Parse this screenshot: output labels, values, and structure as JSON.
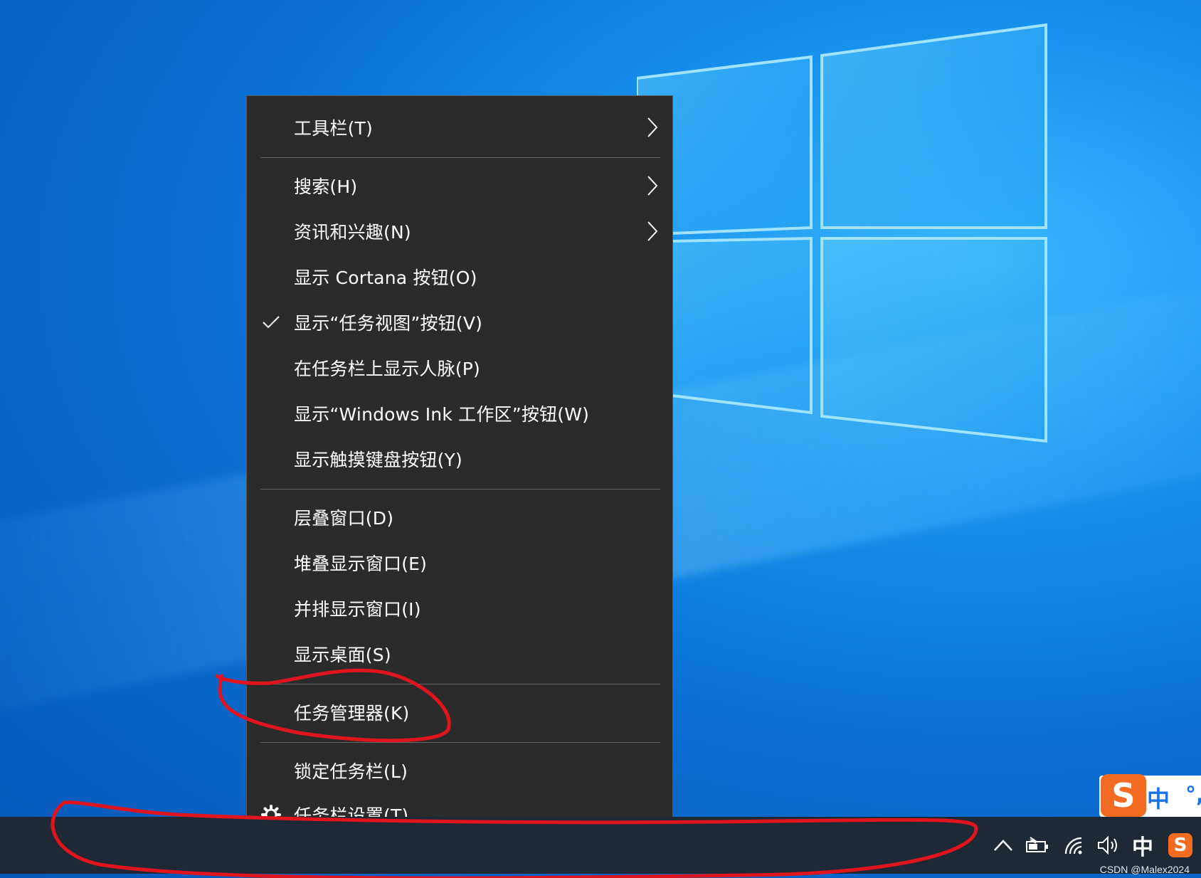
{
  "menu": {
    "items": [
      {
        "label": "工具栏(T)",
        "submenu": true
      },
      {
        "label": "搜索(H)",
        "submenu": true
      },
      {
        "label": "资讯和兴趣(N)",
        "submenu": true
      },
      {
        "label": "显示 Cortana 按钮(O)"
      },
      {
        "label": "显示“任务视图”按钮(V)",
        "checked": true
      },
      {
        "label": "在任务栏上显示人脉(P)"
      },
      {
        "label": "显示“Windows Ink 工作区”按钮(W)"
      },
      {
        "label": "显示触摸键盘按钮(Y)"
      },
      {
        "label": "层叠窗口(D)"
      },
      {
        "label": "堆叠显示窗口(E)"
      },
      {
        "label": "并排显示窗口(I)"
      },
      {
        "label": "显示桌面(S)"
      },
      {
        "label": "任务管理器(K)"
      },
      {
        "label": "锁定任务栏(L)"
      },
      {
        "label": "任务栏设置(T)",
        "icon": "gear-icon"
      }
    ]
  },
  "tray": {
    "ime_language": "中",
    "ime_app_letter": "S"
  },
  "ime_toolbar": {
    "logo_letter": "S",
    "mode": "中",
    "punct": "°,"
  },
  "watermark": "CSDN @Malex2024",
  "colors": {
    "menu_bg": "#2b2b2b",
    "taskbar_bg": "#1f2935",
    "annotation": "#e0141e",
    "sogou_orange": "#f36b21"
  }
}
